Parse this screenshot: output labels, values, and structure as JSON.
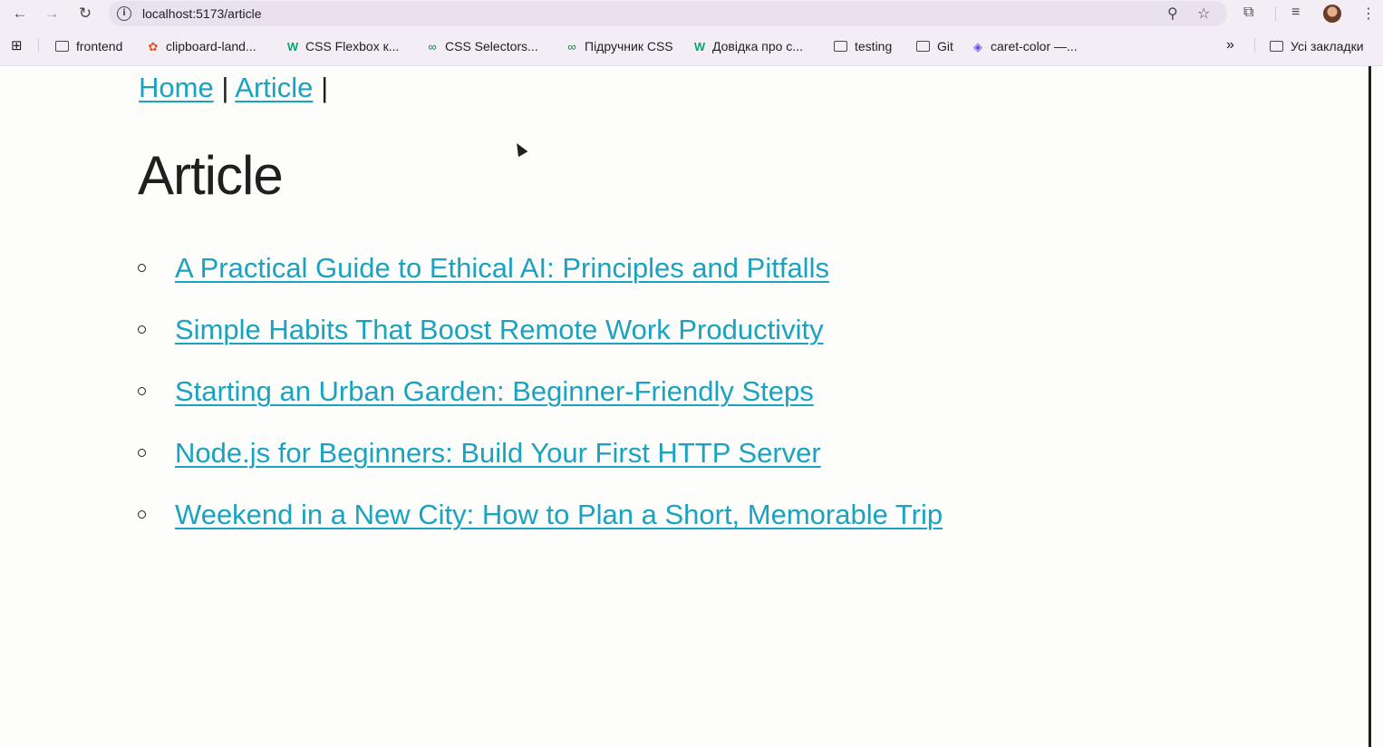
{
  "browser": {
    "url": "localhost:5173/article",
    "bookmarks": [
      {
        "label": "frontend",
        "icon": "folder-icon"
      },
      {
        "label": "clipboard-land...",
        "icon": "figma-icon"
      },
      {
        "label": "CSS Flexbox к...",
        "icon": "w3-icon"
      },
      {
        "label": "CSS Selectors...",
        "icon": "mdn-icon"
      },
      {
        "label": "Підручник CSS",
        "icon": "mdn-icon"
      },
      {
        "label": "Довідка про с...",
        "icon": "w3-icon"
      },
      {
        "label": "testing",
        "icon": "folder-icon"
      },
      {
        "label": "Git",
        "icon": "folder-icon"
      },
      {
        "label": "caret-color —...",
        "icon": "stack-icon"
      }
    ],
    "all_bookmarks": "Усі закладки",
    "overflow": "»"
  },
  "nav": {
    "home": "Home",
    "separator": "|",
    "article": "Article"
  },
  "page": {
    "title": "Article",
    "articles": [
      "A Practical Guide to Ethical AI: Principles and Pitfalls",
      "Simple Habits That Boost Remote Work Productivity",
      "Starting an Urban Garden: Beginner-Friendly Steps",
      "Node.js for Beginners: Build Your First HTTP Server",
      "Weekend in a New City: How to Plan a Short, Memorable Trip"
    ]
  },
  "colors": {
    "link": "#1aa3c1",
    "text": "#1f1f1f",
    "background": "#fdfdfb",
    "browser_chrome": "#f3edf6"
  }
}
